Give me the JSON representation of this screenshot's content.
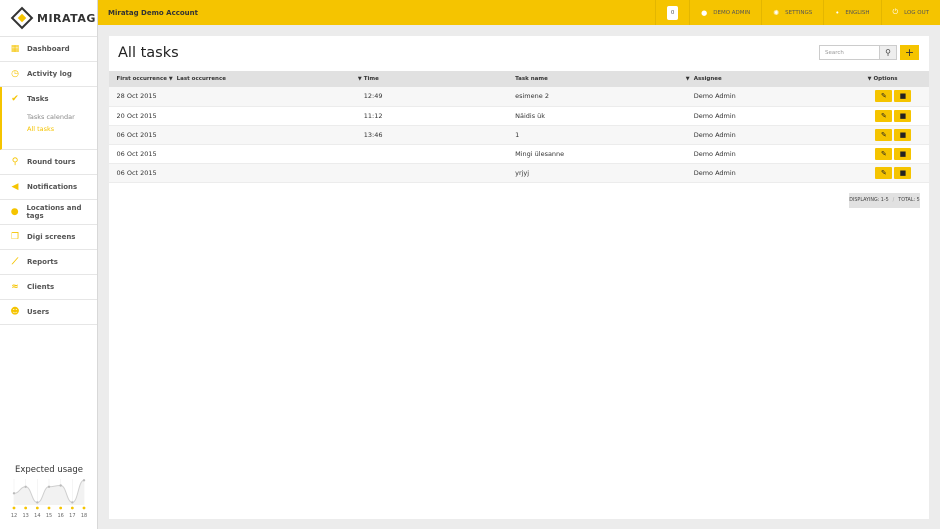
{
  "brand": {
    "logo_text": "MIRATAG"
  },
  "header": {
    "account_name": "Miratag Demo Account",
    "notification_count": "0",
    "user_label": "DEMO ADMIN",
    "settings_label": "SETTINGS",
    "language_label": "ENGLISH",
    "logout_label": "LOG OUT"
  },
  "sidebar": {
    "items": [
      {
        "label": "Dashboard",
        "icon": "grid-icon"
      },
      {
        "label": "Activity log",
        "icon": "history-icon"
      },
      {
        "label": "Tasks",
        "icon": "check-icon",
        "sub": [
          {
            "label": "Tasks calendar"
          },
          {
            "label": "All tasks"
          }
        ]
      },
      {
        "label": "Round tours",
        "icon": "route-icon"
      },
      {
        "label": "Notifications",
        "icon": "megaphone-icon"
      },
      {
        "label": "Locations and tags",
        "icon": "pin-icon"
      },
      {
        "label": "Digi screens",
        "icon": "screens-icon"
      },
      {
        "label": "Reports",
        "icon": "chart-icon"
      },
      {
        "label": "Clients",
        "icon": "handshake-icon"
      },
      {
        "label": "Users",
        "icon": "users-icon"
      }
    ]
  },
  "usage": {
    "title": "Expected usage",
    "days": [
      "12",
      "13",
      "14",
      "15",
      "16",
      "17",
      "18"
    ],
    "values": [
      0.45,
      0.7,
      0.1,
      0.7,
      0.75,
      0.1,
      0.95
    ]
  },
  "main": {
    "title": "All tasks",
    "search_placeholder": "Search",
    "columns": {
      "first": "First occurrence",
      "last": "Last occurrence",
      "time": "Time",
      "name": "Task name",
      "assignee": "Assignee",
      "options": "Options"
    },
    "rows": [
      {
        "first": "28 Oct 2015",
        "time": "12:49",
        "name": "esimene 2",
        "assignee": "Demo Admin"
      },
      {
        "first": "20 Oct 2015",
        "time": "11:12",
        "name": "Näidis ük",
        "assignee": "Demo Admin"
      },
      {
        "first": "06 Oct 2015",
        "time": "13:46",
        "name": "1",
        "assignee": "Demo Admin"
      },
      {
        "first": "06 Oct 2015",
        "time": "",
        "name": "Mingi ülesanne",
        "assignee": "Demo Admin"
      },
      {
        "first": "06 Oct 2015",
        "time": "",
        "name": "yrjyj",
        "assignee": "Demo Admin"
      }
    ],
    "paging": {
      "displaying": "DISPLAYING: 1-5",
      "total": "TOTAL: 5"
    }
  },
  "colors": {
    "accent": "#f5c400"
  }
}
